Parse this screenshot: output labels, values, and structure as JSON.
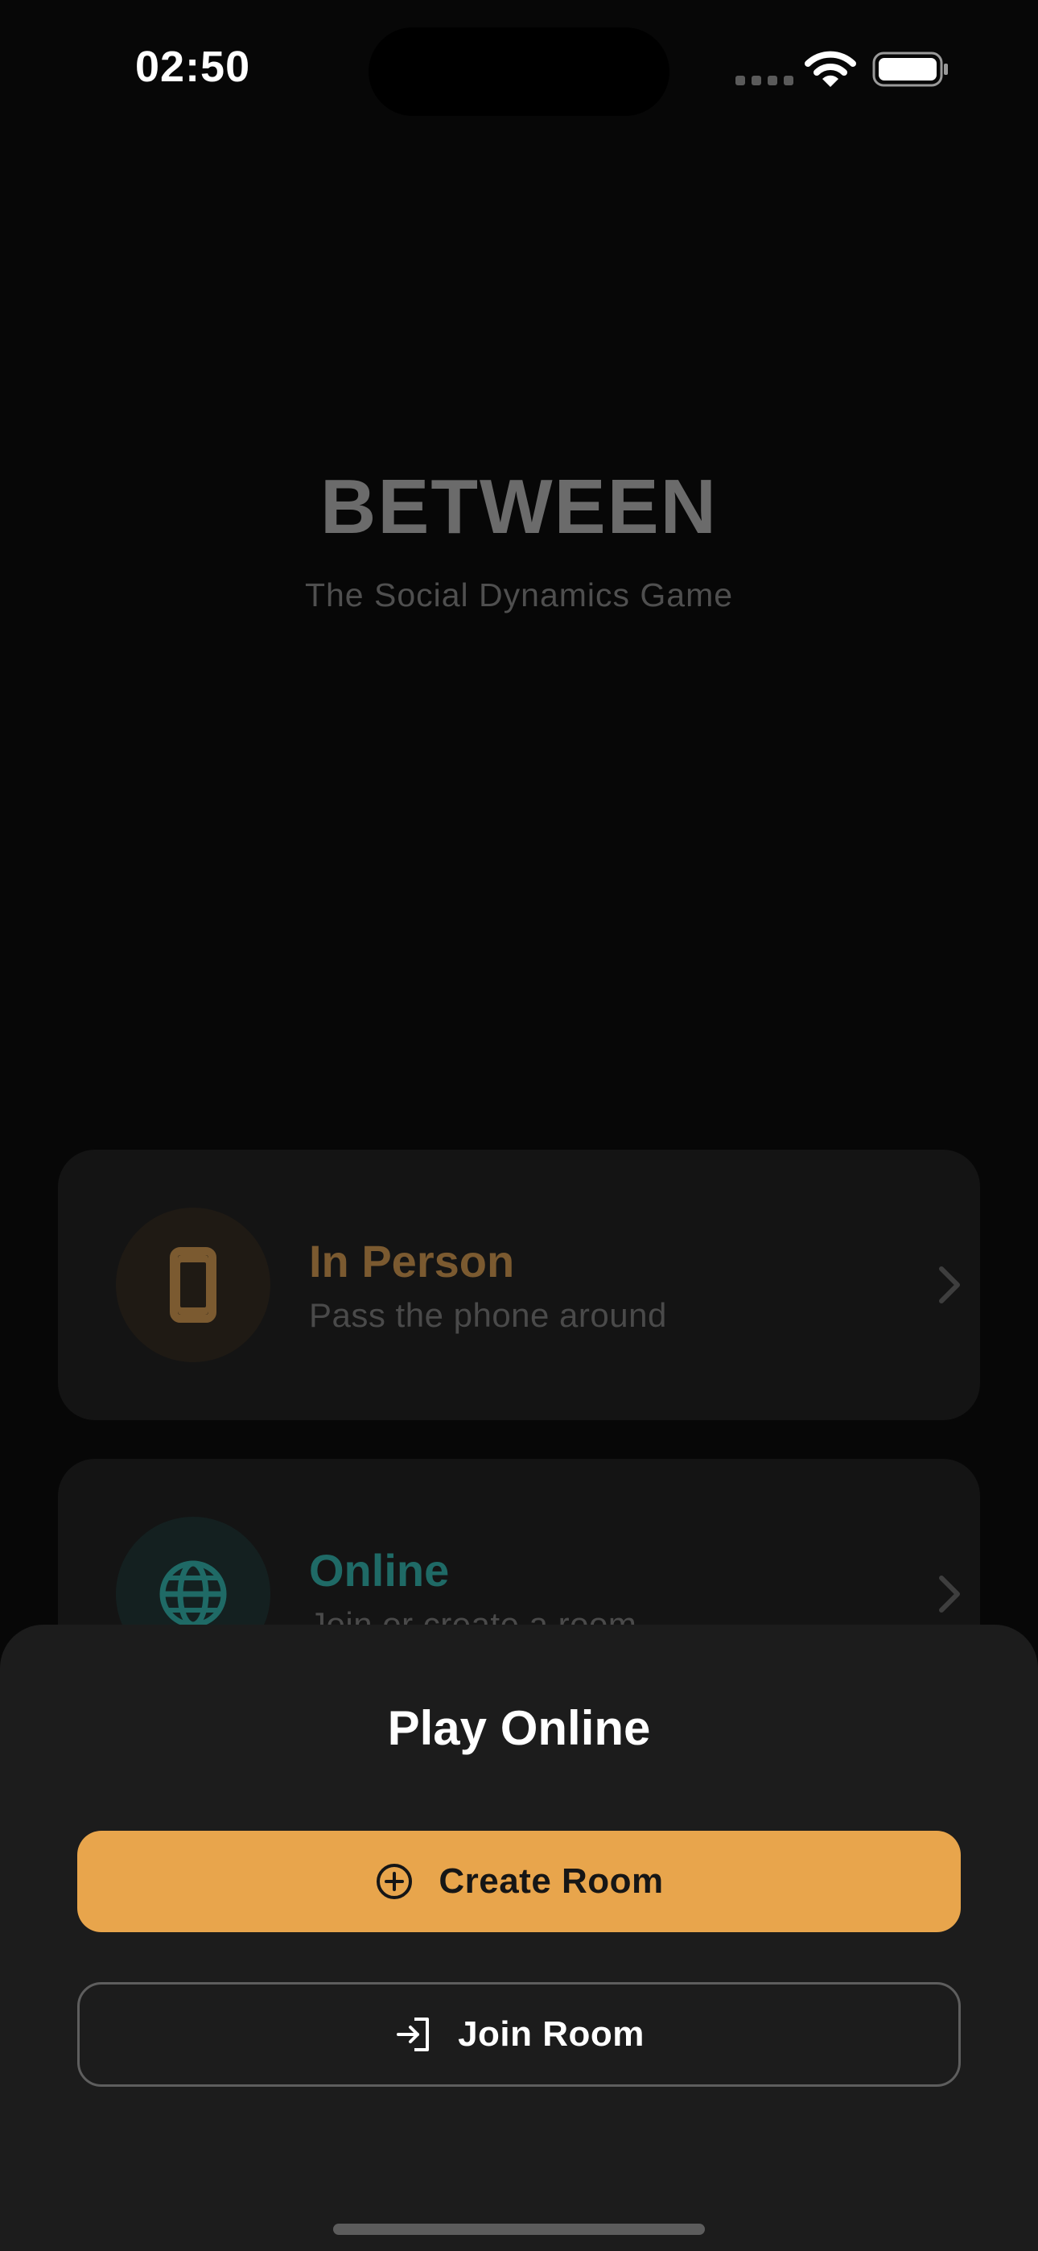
{
  "status_bar": {
    "time": "02:50",
    "icons": [
      "signal-dots-icon",
      "wifi-icon",
      "battery-icon"
    ]
  },
  "app": {
    "title": "BETWEEN",
    "subtitle": "The Social Dynamics Game"
  },
  "modes": [
    {
      "title": "In Person",
      "description": "Pass the phone around",
      "icon": "phone-icon",
      "accent": "#7b5a30"
    },
    {
      "title": "Online",
      "description": "Join or create a room",
      "icon": "globe-icon",
      "accent": "#1f6a66"
    }
  ],
  "sheet": {
    "title": "Play Online",
    "create_label": "Create Room",
    "create_icon": "plus-circle-icon",
    "join_label": "Join Room",
    "join_icon": "sign-in-icon"
  },
  "colors": {
    "background": "#070707",
    "card": "#141414",
    "sheet": "#1c1c1c",
    "primary_button": "#e8a54c"
  }
}
